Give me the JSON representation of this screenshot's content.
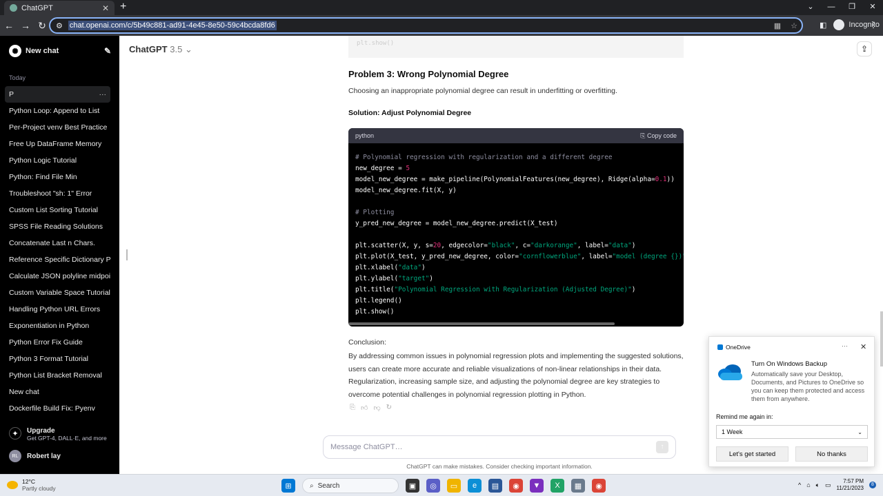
{
  "browser": {
    "tab_title": "ChatGPT",
    "url": "chat.openai.com/c/5b49c881-ad91-4e45-8e50-59c4bcda8fd6",
    "profile": "Incognito"
  },
  "sidebar": {
    "new_chat": "New chat",
    "section": "Today",
    "items": [
      {
        "label": "P"
      },
      {
        "label": "Python Loop: Append to List"
      },
      {
        "label": "Per-Project venv Best Practice"
      },
      {
        "label": "Free Up DataFrame Memory"
      },
      {
        "label": "Python Logic Tutorial"
      },
      {
        "label": "Python: Find File Min"
      },
      {
        "label": "Troubleshoot \"sh: 1\" Error"
      },
      {
        "label": "Custom List Sorting Tutorial"
      },
      {
        "label": "SPSS File Reading Solutions"
      },
      {
        "label": "Concatenate Last n Chars."
      },
      {
        "label": "Reference Specific Dictionary Pa"
      },
      {
        "label": "Calculate JSON polyline midpoint"
      },
      {
        "label": "Custom Variable Space Tutorial"
      },
      {
        "label": "Handling Python URL Errors"
      },
      {
        "label": "Exponentiation in Python"
      },
      {
        "label": "Python Error Fix Guide"
      },
      {
        "label": "Python 3 Format Tutorial"
      },
      {
        "label": "Python List Bracket Removal"
      },
      {
        "label": "New chat"
      },
      {
        "label": "Dockerfile Build Fix: Pyenv"
      }
    ],
    "upgrade_title": "Upgrade",
    "upgrade_sub": "Get GPT-4, DALL·E, and more",
    "user_initials": "RL",
    "user_name": "Robert lay"
  },
  "main": {
    "model_name": "ChatGPT",
    "model_version": "3.5",
    "top_code_tail": "plt.show()",
    "heading": "Problem 3: Wrong Polynomial Degree",
    "intro": "Choosing an inappropriate polynomial degree can result in underfitting or overfitting.",
    "solution": "Solution: Adjust Polynomial Degree",
    "code_lang": "python",
    "copy_label": "Copy code",
    "conclusion_label": "Conclusion:",
    "conclusion": "By addressing common issues in polynomial regression plots and implementing the suggested solutions, users can create more accurate and reliable visualizations of non-linear relationships in their data. Regularization, increasing sample size, and adjusting the polynomial degree are key strategies to overcome potential challenges in polynomial regression plotting in Python.",
    "composer_placeholder": "Message ChatGPT…",
    "disclaimer": "ChatGPT can make mistakes. Consider checking important information."
  },
  "onedrive": {
    "app": "OneDrive",
    "title": "Turn On Windows Backup",
    "body": "Automatically save your Desktop, Documents, and Pictures to OneDrive so you can keep them protected and access them from anywhere.",
    "remind_label": "Remind me again in:",
    "remind_value": "1 Week",
    "primary": "Let's get started",
    "secondary": "No thanks"
  },
  "taskbar": {
    "temp": "12°C",
    "weather": "Partly cloudy",
    "search": "Search",
    "time": "7:57 PM",
    "date": "11/21/2023",
    "notifications": "8"
  }
}
